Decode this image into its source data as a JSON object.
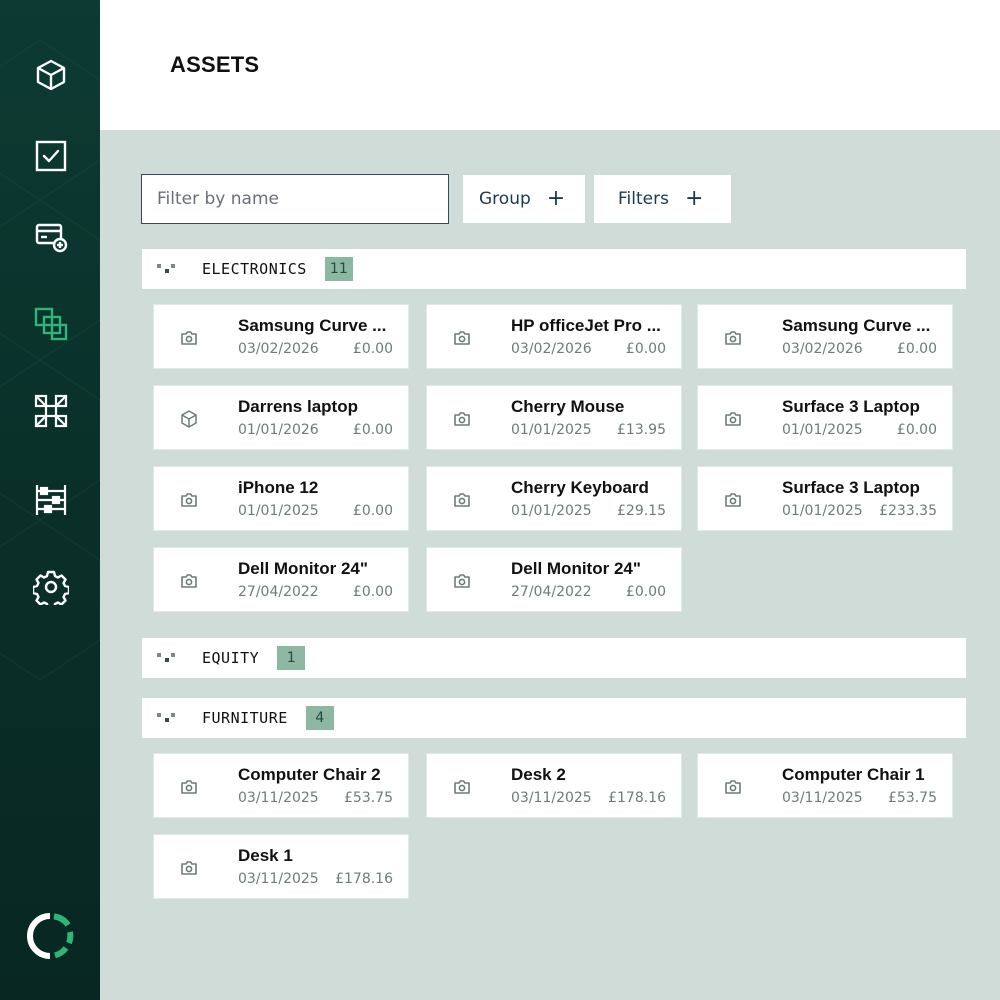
{
  "page": {
    "title": "ASSETS"
  },
  "sidebar": {
    "items": [
      {
        "name": "cube-icon",
        "active": false
      },
      {
        "name": "checkbox-icon",
        "active": false
      },
      {
        "name": "card-add-icon",
        "active": false
      },
      {
        "name": "copy-squares-icon",
        "active": true
      },
      {
        "name": "network-nodes-icon",
        "active": false
      },
      {
        "name": "abacus-icon",
        "active": false
      },
      {
        "name": "gear-icon",
        "active": false
      }
    ],
    "logo": "ring-logo"
  },
  "toolbar": {
    "search_placeholder": "Filter by name",
    "search_value": "",
    "group_label": "Group",
    "filters_label": "Filters",
    "plus": "+"
  },
  "groups": [
    {
      "name": "ELECTRONICS",
      "count": "11",
      "items": [
        {
          "name": "Samsung Curve ...",
          "date": "03/02/2026",
          "price": "£0.00",
          "icon": "camera-icon"
        },
        {
          "name": "HP officeJet Pro ...",
          "date": "03/02/2026",
          "price": "£0.00",
          "icon": "camera-icon"
        },
        {
          "name": "Samsung Curve ...",
          "date": "03/02/2026",
          "price": "£0.00",
          "icon": "camera-icon"
        },
        {
          "name": "Darrens laptop",
          "date": "01/01/2026",
          "price": "£0.00",
          "icon": "cube-icon"
        },
        {
          "name": "Cherry Mouse",
          "date": "01/01/2025",
          "price": "£13.95",
          "icon": "camera-icon"
        },
        {
          "name": "Surface 3 Laptop",
          "date": "01/01/2025",
          "price": "£0.00",
          "icon": "camera-icon"
        },
        {
          "name": "iPhone 12",
          "date": "01/01/2025",
          "price": "£0.00",
          "icon": "camera-icon"
        },
        {
          "name": "Cherry Keyboard",
          "date": "01/01/2025",
          "price": "£29.15",
          "icon": "camera-icon"
        },
        {
          "name": "Surface 3 Laptop",
          "date": "01/01/2025",
          "price": "£233.35",
          "icon": "camera-icon"
        },
        {
          "name": "Dell Monitor 24\"",
          "date": "27/04/2022",
          "price": "£0.00",
          "icon": "camera-icon"
        },
        {
          "name": "Dell Monitor 24\"",
          "date": "27/04/2022",
          "price": "£0.00",
          "icon": "camera-icon"
        }
      ]
    },
    {
      "name": "EQUITY",
      "count": "1",
      "items": []
    },
    {
      "name": "FURNITURE",
      "count": "4",
      "items": [
        {
          "name": "Computer Chair 2",
          "date": "03/11/2025",
          "price": "£53.75",
          "icon": "camera-icon"
        },
        {
          "name": "Desk 2",
          "date": "03/11/2025",
          "price": "£178.16",
          "icon": "camera-icon"
        },
        {
          "name": "Computer Chair 1",
          "date": "03/11/2025",
          "price": "£53.75",
          "icon": "camera-icon"
        },
        {
          "name": "Desk 1",
          "date": "03/11/2025",
          "price": "£178.16",
          "icon": "camera-icon"
        }
      ]
    }
  ],
  "colors": {
    "sidebar": "#0a2f29",
    "accent": "#2fb57a",
    "background": "#cfdcd8",
    "count_badge": "#8cb8a2"
  }
}
